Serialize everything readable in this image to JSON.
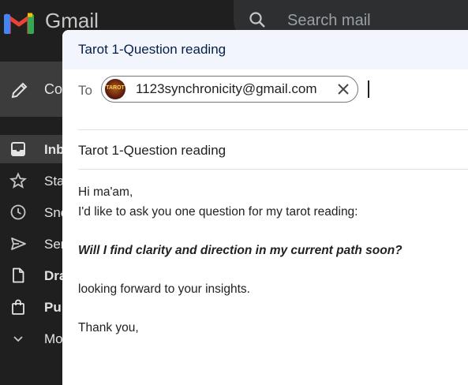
{
  "app": {
    "brand": "Gmail",
    "search_placeholder": "Search mail",
    "compose_label": "Co"
  },
  "sidebar": {
    "items": [
      {
        "label": "Inb",
        "icon": "inbox-icon",
        "active": true,
        "bold": true
      },
      {
        "label": "Sta",
        "icon": "star-icon"
      },
      {
        "label": "Sno",
        "icon": "snooze-clock-icon"
      },
      {
        "label": "Ser",
        "icon": "send-icon"
      },
      {
        "label": "Dra",
        "icon": "draft-file-icon",
        "bold": true
      },
      {
        "label": "Pu",
        "icon": "shopping-bag-icon",
        "bold": true
      },
      {
        "label": "Mo",
        "icon": "chevron-down-icon"
      }
    ]
  },
  "compose": {
    "title": "Tarot 1-Question reading",
    "to_label": "To",
    "recipient": {
      "email": "1123synchronicity@gmail.com",
      "avatar_text": "TAROT"
    },
    "subject": "Tarot 1-Question reading",
    "body": {
      "line1": "Hi ma'am,",
      "line2": "I'd like to ask you one question for my tarot reading:",
      "question": "Will I find clarity and direction in my current path soon?",
      "line4": "looking forward to your insights.",
      "line5": "Thank you,"
    }
  },
  "colors": {
    "background": "#1f1f1f",
    "compose_header": "#f2f6fc",
    "title_text": "#041e49"
  }
}
